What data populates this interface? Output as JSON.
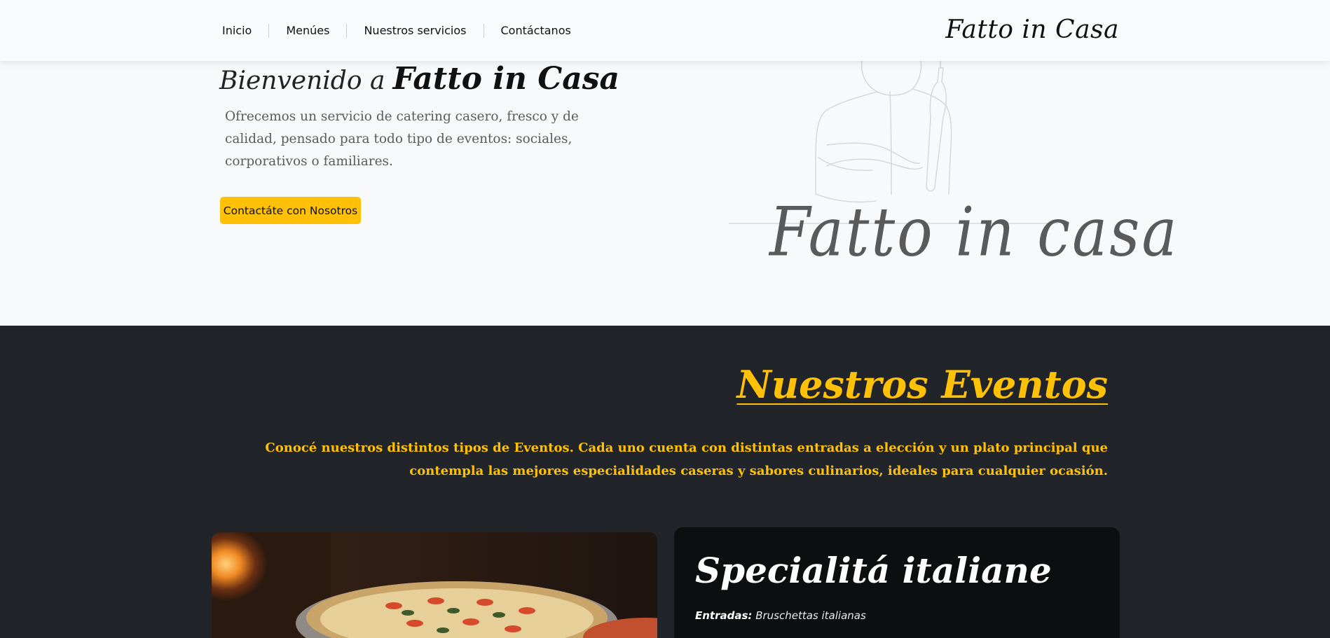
{
  "nav": {
    "links": [
      "Inicio",
      "Menúes",
      "Nuestros servicios",
      "Contáctanos"
    ],
    "brand": "Fatto in Casa"
  },
  "hero": {
    "title_prefix": "Bienvenido a",
    "title_brand": "Fatto in Casa",
    "description": "Ofrecemos un servicio de catering casero, fresco y de calidad, pensado para todo tipo de eventos: sociales, corporativos o familiares.",
    "button_label": "Contactáte con Nosotros",
    "logo_text": "Fatto in casa"
  },
  "events": {
    "title": "Nuestros Eventos",
    "description": "Conocé nuestros distintos tipos de Eventos. Cada uno cuenta con distintas entradas a elección y un plato principal que contempla las mejores especialidades caseras y sabores culinarios, ideales para cualquier ocasión.",
    "card": {
      "title": "Specialitá italiane",
      "entry_label": "Entradas:",
      "entry_value": "Bruschettas italianas"
    }
  },
  "colors": {
    "accent": "#ffc107",
    "dark": "#212529",
    "card": "#0d0e10"
  }
}
